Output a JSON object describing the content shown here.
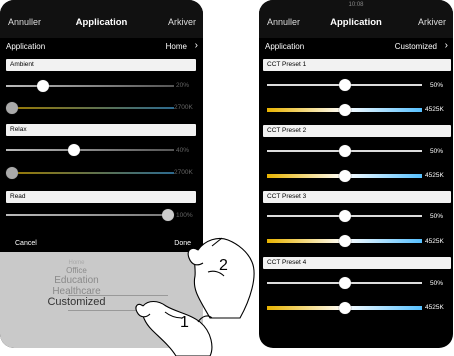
{
  "left_phone": {
    "nav": {
      "left": "Annuller",
      "title": "Application",
      "right": "Arkiver"
    },
    "appbar": {
      "label": "Application",
      "value": "Home"
    },
    "sections": [
      {
        "name": "Ambient",
        "brightness_label": "20%",
        "brightness": 0.2,
        "cct_label": "2700K",
        "cct": 0.0
      },
      {
        "name": "Relax",
        "brightness_label": "40%",
        "brightness": 0.4,
        "cct_label": "2700K",
        "cct": 0.0
      },
      {
        "name": "Read",
        "brightness_label": "100%",
        "brightness": 1.0
      }
    ],
    "footer": {
      "cancel": "Cancel",
      "done": "Done"
    },
    "picker": {
      "items": [
        "Home",
        "Office",
        "Education",
        "Healthcare",
        "Customized"
      ],
      "selected": "Customized"
    }
  },
  "right_phone": {
    "nav": {
      "status": "10:08",
      "left": "Annuller",
      "title": "Application",
      "right": "Arkiver"
    },
    "appbar": {
      "label": "Application",
      "value": "Customized"
    },
    "presets": [
      {
        "name": "CCT Preset 1",
        "brightness_label": "50%",
        "brightness": 0.5,
        "cct_label": "4525K",
        "cct": 0.5
      },
      {
        "name": "CCT Preset 2",
        "brightness_label": "50%",
        "brightness": 0.5,
        "cct_label": "4525K",
        "cct": 0.5
      },
      {
        "name": "CCT Preset 3",
        "brightness_label": "50%",
        "brightness": 0.5,
        "cct_label": "4525K",
        "cct": 0.5
      },
      {
        "name": "CCT Preset 4",
        "brightness_label": "50%",
        "brightness": 0.5,
        "cct_label": "4525K",
        "cct": 0.5
      }
    ]
  },
  "callouts": {
    "step1": "1",
    "step2": "2"
  },
  "icons": {
    "chevron": "chevron-right-icon"
  },
  "colors": {
    "phone_bg": "#000000",
    "header_bg": "#f2f2f2",
    "picker_bg": "#c9c9c9",
    "cct_gradient_left": "#e8b300",
    "cct_gradient_right": "#56c0ff"
  }
}
